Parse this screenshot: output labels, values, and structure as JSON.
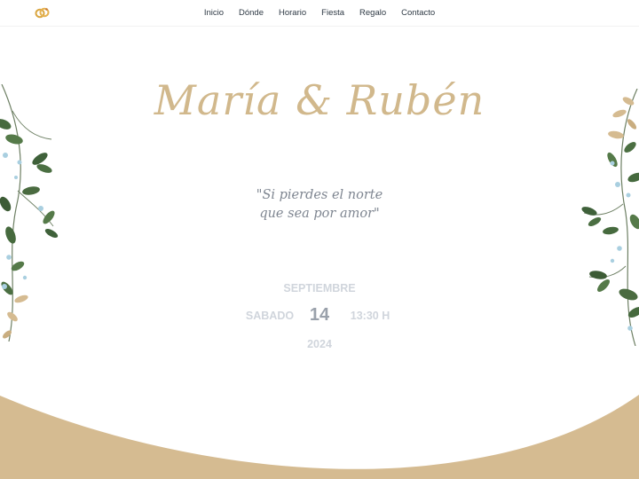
{
  "nav": {
    "logo_icon": "rings-icon",
    "links": [
      "Inicio",
      "Dónde",
      "Horario",
      "Fiesta",
      "Regalo",
      "Contacto"
    ]
  },
  "hero": {
    "title": "María & Rubén",
    "quote_line1": "\"Si pierdes el norte",
    "quote_line2": "que sea por amor\""
  },
  "event": {
    "month": "SEPTIEMBRE",
    "weekday": "SABADO",
    "day": "14",
    "time": "13:30 H",
    "year": "2024"
  },
  "colors": {
    "accent": "#d1b88c",
    "wave": "#d5bb91",
    "leaf_dark": "#4f6e45",
    "leaf_light": "#a9cfe0",
    "text": "#7f8691"
  }
}
